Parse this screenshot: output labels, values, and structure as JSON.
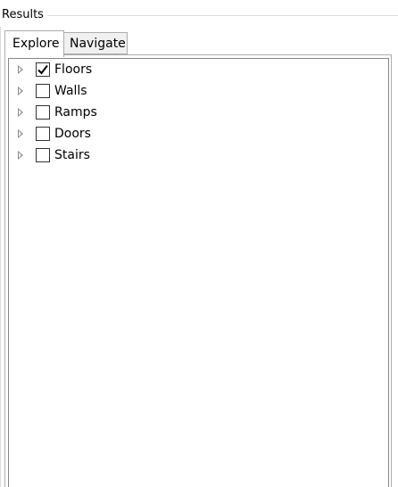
{
  "group": {
    "title": "Results"
  },
  "tabs": [
    {
      "label": "Explore",
      "selected": true
    },
    {
      "label": "Navigate",
      "selected": false
    }
  ],
  "tree": {
    "items": [
      {
        "label": "Floors",
        "checked": true,
        "icon": "expand-arrow-icon"
      },
      {
        "label": "Walls",
        "checked": false,
        "icon": "expand-arrow-icon"
      },
      {
        "label": "Ramps",
        "checked": false,
        "icon": "expand-arrow-icon"
      },
      {
        "label": "Doors",
        "checked": false,
        "icon": "expand-arrow-icon"
      },
      {
        "label": "Stairs",
        "checked": false,
        "icon": "expand-arrow-icon"
      }
    ]
  },
  "colors": {
    "border": "#acacac",
    "tree_border": "#828790",
    "inactive_tab": "#f0f0f0",
    "expander": "#8c8c8c"
  }
}
